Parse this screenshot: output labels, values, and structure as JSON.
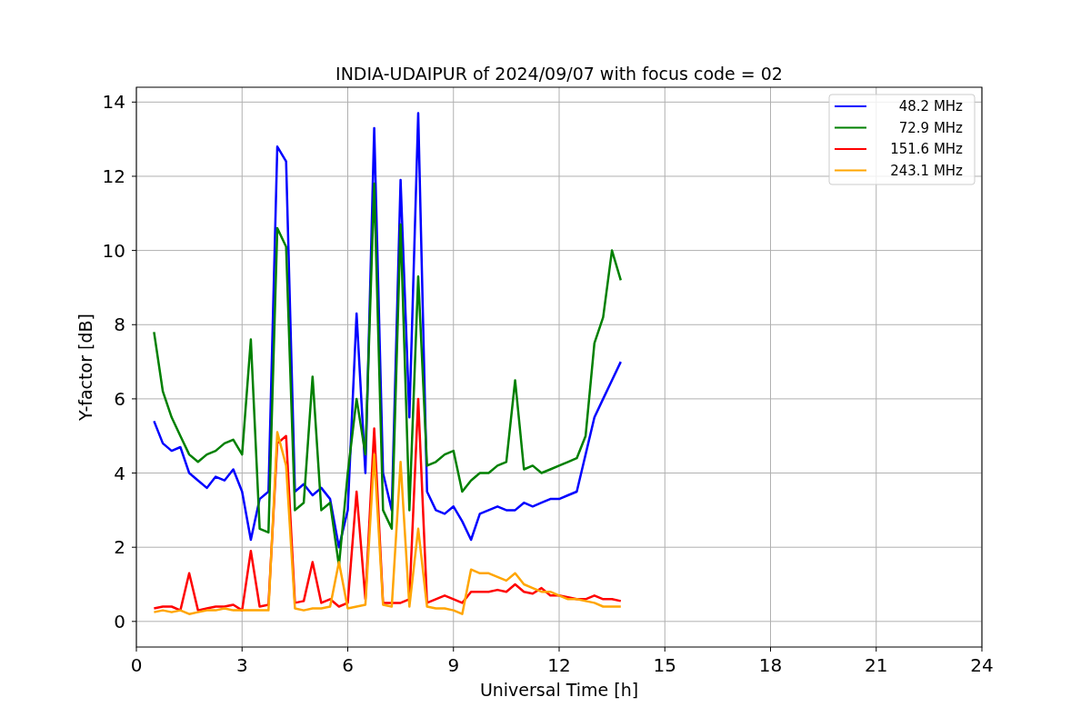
{
  "chart_data": {
    "type": "line",
    "title": "INDIA-UDAIPUR of 2024/09/07 with focus code = 02",
    "xlabel": "Universal Time [h]",
    "ylabel": "Y-factor [dB]",
    "x": [
      0.5,
      0.75,
      1.0,
      1.25,
      1.5,
      1.75,
      2.0,
      2.25,
      2.5,
      2.75,
      3.0,
      3.25,
      3.5,
      3.75,
      4.0,
      4.25,
      4.5,
      4.75,
      5.0,
      5.25,
      5.5,
      5.75,
      6.0,
      6.25,
      6.5,
      6.75,
      7.0,
      7.25,
      7.5,
      7.75,
      8.0,
      8.25,
      8.5,
      8.75,
      9.0,
      9.25,
      9.5,
      9.75,
      10.0,
      10.25,
      10.5,
      10.75,
      11.0,
      11.25,
      11.5,
      11.75,
      12.0,
      12.25,
      12.5,
      12.75,
      13.0,
      13.25,
      13.5,
      13.75
    ],
    "series": [
      {
        "name": "48.2 MHz",
        "color": "#0000ff",
        "values": [
          5.4,
          4.8,
          4.6,
          4.7,
          4.0,
          3.8,
          3.6,
          3.9,
          3.8,
          4.1,
          3.5,
          2.2,
          3.3,
          3.5,
          12.8,
          12.4,
          3.5,
          3.7,
          3.4,
          3.6,
          3.3,
          2.0,
          3.0,
          8.3,
          4.0,
          13.3,
          4.0,
          3.0,
          11.9,
          5.5,
          13.7,
          3.5,
          3.0,
          2.9,
          3.1,
          2.7,
          2.2,
          2.9,
          3.0,
          3.1,
          3.0,
          3.0,
          3.2,
          3.1,
          3.2,
          3.3,
          3.3,
          3.4,
          3.5,
          4.5,
          5.5,
          6.0,
          6.5,
          7.0
        ]
      },
      {
        "name": "72.9 MHz",
        "color": "#008000",
        "values": [
          7.8,
          6.2,
          5.5,
          5.0,
          4.5,
          4.3,
          4.5,
          4.6,
          4.8,
          4.9,
          4.5,
          7.6,
          2.5,
          2.4,
          10.6,
          10.1,
          3.0,
          3.2,
          6.6,
          3.0,
          3.2,
          1.5,
          4.0,
          6.0,
          4.5,
          11.8,
          3.0,
          2.5,
          10.7,
          3.0,
          9.3,
          4.2,
          4.3,
          4.5,
          4.6,
          3.5,
          3.8,
          4.0,
          4.0,
          4.2,
          4.3,
          6.5,
          4.1,
          4.2,
          4.0,
          4.1,
          4.2,
          4.3,
          4.4,
          5.0,
          7.5,
          8.2,
          10.0,
          9.2
        ]
      },
      {
        "name": "151.6 MHz",
        "color": "#ff0000",
        "values": [
          0.35,
          0.4,
          0.4,
          0.3,
          1.3,
          0.3,
          0.35,
          0.4,
          0.4,
          0.45,
          0.3,
          1.9,
          0.4,
          0.45,
          4.8,
          5.0,
          0.5,
          0.55,
          1.6,
          0.5,
          0.6,
          0.4,
          0.5,
          3.5,
          0.6,
          5.2,
          0.5,
          0.5,
          0.5,
          0.6,
          6.0,
          0.5,
          0.6,
          0.7,
          0.6,
          0.5,
          0.8,
          0.8,
          0.8,
          0.85,
          0.8,
          1.0,
          0.8,
          0.75,
          0.9,
          0.7,
          0.7,
          0.65,
          0.6,
          0.6,
          0.7,
          0.6,
          0.6,
          0.55
        ]
      },
      {
        "name": "243.1 MHz",
        "color": "#ffa500",
        "values": [
          0.25,
          0.3,
          0.25,
          0.3,
          0.2,
          0.25,
          0.3,
          0.3,
          0.35,
          0.3,
          0.3,
          0.3,
          0.3,
          0.3,
          5.1,
          4.2,
          0.35,
          0.3,
          0.35,
          0.35,
          0.4,
          1.6,
          0.35,
          0.4,
          0.45,
          4.5,
          0.45,
          0.4,
          4.3,
          0.4,
          2.5,
          0.4,
          0.35,
          0.35,
          0.3,
          0.2,
          1.4,
          1.3,
          1.3,
          1.2,
          1.1,
          1.3,
          1.0,
          0.9,
          0.8,
          0.8,
          0.7,
          0.6,
          0.6,
          0.55,
          0.5,
          0.4,
          0.4,
          0.4
        ]
      }
    ],
    "grid": true,
    "legend": true,
    "xlim": [
      0,
      24
    ],
    "ylim": [
      -0.69,
      14.4
    ],
    "xticks": [
      0,
      3,
      6,
      9,
      12,
      15,
      18,
      21,
      24
    ],
    "yticks": [
      0,
      2,
      4,
      6,
      8,
      10,
      12,
      14
    ]
  }
}
